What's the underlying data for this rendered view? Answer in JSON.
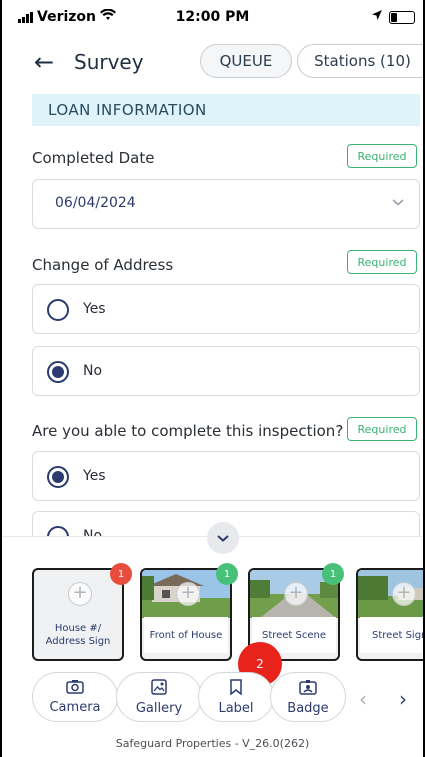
{
  "status_bar": {
    "carrier": "Verizon",
    "time": "12:00 PM"
  },
  "header": {
    "title": "Survey",
    "queue_label": "QUEUE",
    "stations_label": "Stations (10)"
  },
  "section": {
    "title": "LOAN INFORMATION"
  },
  "required_label": "Required",
  "questions": {
    "completed_date": {
      "label": "Completed Date",
      "value": "06/04/2024"
    },
    "change_of_address": {
      "label": "Change of Address",
      "options": [
        "Yes",
        "No"
      ],
      "selected": "No"
    },
    "able_to_complete": {
      "label": "Are you able to complete this inspection?",
      "options": [
        "Yes",
        "No"
      ],
      "selected": "Yes"
    }
  },
  "photos": [
    {
      "caption": "House #/ Address Sign",
      "count": "1",
      "badge_color": "#e74c3c"
    },
    {
      "caption": "Front of House",
      "count": "1",
      "badge_color": "#48c07a"
    },
    {
      "caption": "Street Scene",
      "count": "1",
      "badge_color": "#48c07a"
    },
    {
      "caption": "Street Sign",
      "count": ""
    }
  ],
  "notification_count": "2",
  "actions": {
    "camera": "Camera",
    "gallery": "Gallery",
    "label": "Label",
    "badge": "Badge"
  },
  "footer": "Safeguard Properties - V_26.0(262)",
  "colors": {
    "accent": "#2c3b6f",
    "required": "#3bb273",
    "section_bg": "#dff3fa",
    "alert": "#e8231b"
  }
}
